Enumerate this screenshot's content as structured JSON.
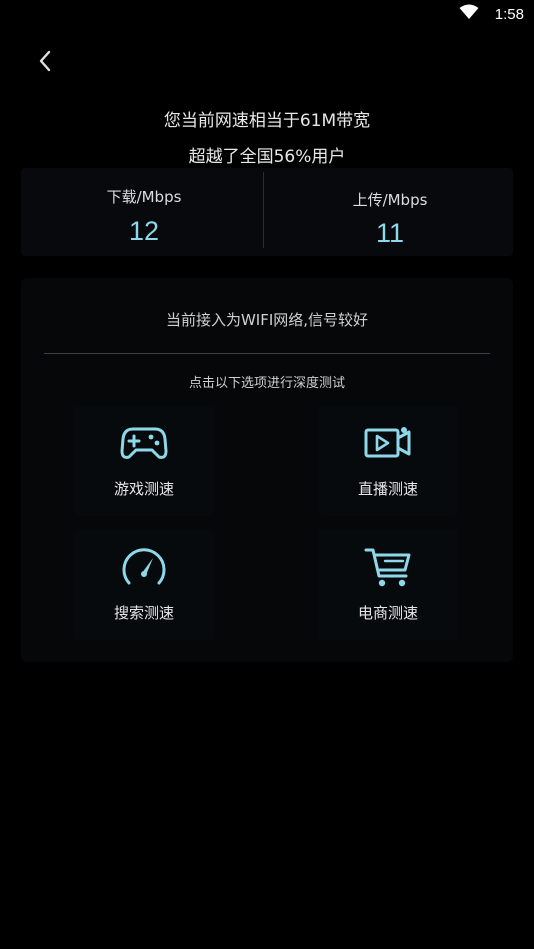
{
  "status_bar": {
    "time": "1:58"
  },
  "header": {
    "line1": "您当前网速相当于61M带宽",
    "line2": "超越了全国56%用户"
  },
  "speed": {
    "download_label": "下载/Mbps",
    "download_value": "12",
    "upload_label": "上传/Mbps",
    "upload_value": "11"
  },
  "panel": {
    "network_status": "当前接入为WIFI网络,信号较好",
    "hint": "点击以下选项进行深度测试",
    "options": [
      {
        "label": "游戏测速",
        "icon": "gamepad-icon"
      },
      {
        "label": "直播测速",
        "icon": "video-camera-icon"
      },
      {
        "label": "搜索测速",
        "icon": "speedometer-icon"
      },
      {
        "label": "电商测速",
        "icon": "shopping-cart-icon"
      }
    ]
  },
  "colors": {
    "background": "#000000",
    "accent": "#8ed8ea",
    "text": "#e6e6e6"
  }
}
